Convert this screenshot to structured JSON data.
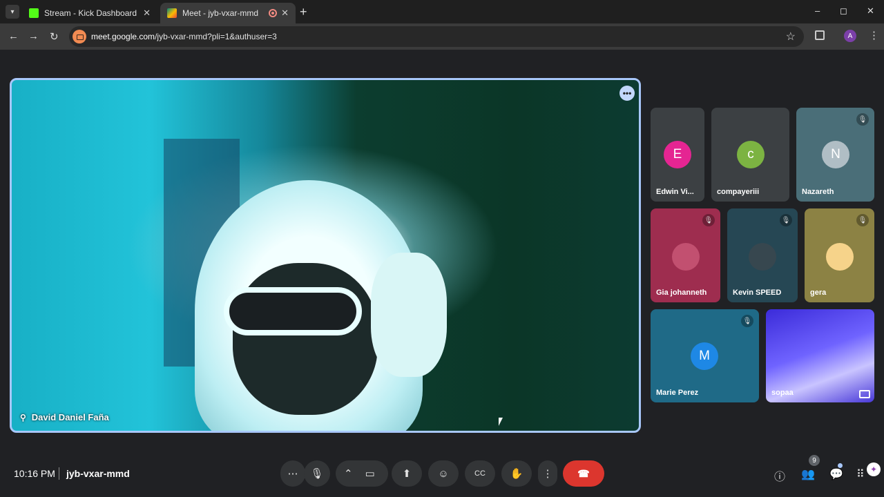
{
  "browser": {
    "tabs": [
      {
        "title": "Stream - Kick Dashboard",
        "favicon_color": "#53fc18",
        "active": false
      },
      {
        "title": "Meet - jyb-vxar-mmd",
        "favicon_color": "#00897b",
        "active": true
      }
    ],
    "url": {
      "host": "meet.google.com",
      "path": "/jyb-vxar-mmd?pli=1&authuser=3"
    },
    "profile_initial": "A",
    "icons": {
      "new_tab": "+",
      "minimize": "–",
      "maximize": "◻",
      "close": "✕",
      "back": "←",
      "forward": "→",
      "reload": "↻",
      "star": "☆",
      "menu": "⋮"
    }
  },
  "meet": {
    "main_speaker": {
      "name": "David Daniel Faña"
    },
    "participants": [
      {
        "name": "Edwin Vi...",
        "initial": "E",
        "avatar_color": "#e52592",
        "muted": false
      },
      {
        "name": "compayeriii",
        "initial": "c",
        "avatar_color": "#7cb342",
        "muted": false
      },
      {
        "name": "Nazareth",
        "initial": "N",
        "avatar_color": "#b0bec5",
        "muted": true
      },
      {
        "name": "Gia johanneth",
        "initial": "",
        "avatar_color": "#c25070",
        "muted": true
      },
      {
        "name": "Kevin SPEED",
        "initial": "",
        "avatar_color": "#37474f",
        "muted": true
      },
      {
        "name": "gera",
        "initial": "",
        "avatar_color": "#f6d38a",
        "muted": true
      },
      {
        "name": "Marie Perez",
        "initial": "M",
        "avatar_color": "#1e88e5",
        "muted": true
      },
      {
        "name": "sopaa",
        "initial": "",
        "avatar_color": "#5b6cf7",
        "muted": false
      }
    ],
    "bottom": {
      "time": "10:16 PM",
      "meeting_code": "jyb-vxar-mmd",
      "people_count": "9"
    },
    "controls": {
      "more_options": "⋯",
      "mic": "🎙",
      "expand": "⌃",
      "camera": "▭",
      "present": "⬆",
      "emoji": "☺",
      "captions": "CC",
      "raise_hand": "✋",
      "kebab": "⋮",
      "end_call": "☎"
    },
    "right_icons": {
      "info": "ⓘ",
      "people": "👥",
      "chat": "💬",
      "activities": "⠿"
    }
  }
}
